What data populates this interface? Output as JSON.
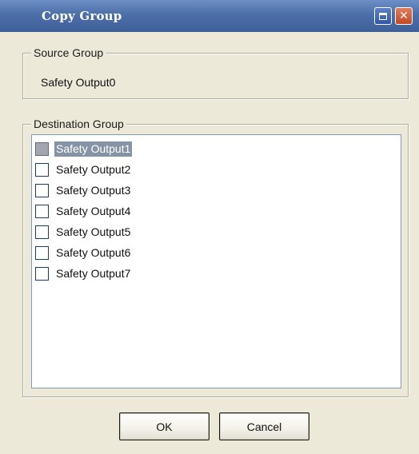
{
  "window": {
    "title": "Copy Group",
    "maximize_icon": "maximize-icon",
    "close_icon": "close-icon"
  },
  "source_group": {
    "legend": "Source Group",
    "value": "Safety Output0"
  },
  "destination_group": {
    "legend": "Destination Group",
    "items": [
      {
        "label": "Safety Output1",
        "checked": false,
        "selected": true
      },
      {
        "label": "Safety Output2",
        "checked": false,
        "selected": false
      },
      {
        "label": "Safety Output3",
        "checked": false,
        "selected": false
      },
      {
        "label": "Safety Output4",
        "checked": false,
        "selected": false
      },
      {
        "label": "Safety Output5",
        "checked": false,
        "selected": false
      },
      {
        "label": "Safety Output6",
        "checked": false,
        "selected": false
      },
      {
        "label": "Safety Output7",
        "checked": false,
        "selected": false
      }
    ]
  },
  "buttons": {
    "ok_label": "OK",
    "cancel_label": "Cancel"
  },
  "colors": {
    "titlebar": "#4d6fa8",
    "dialog_background": "#ece9d8",
    "selection": "#8593a6"
  }
}
